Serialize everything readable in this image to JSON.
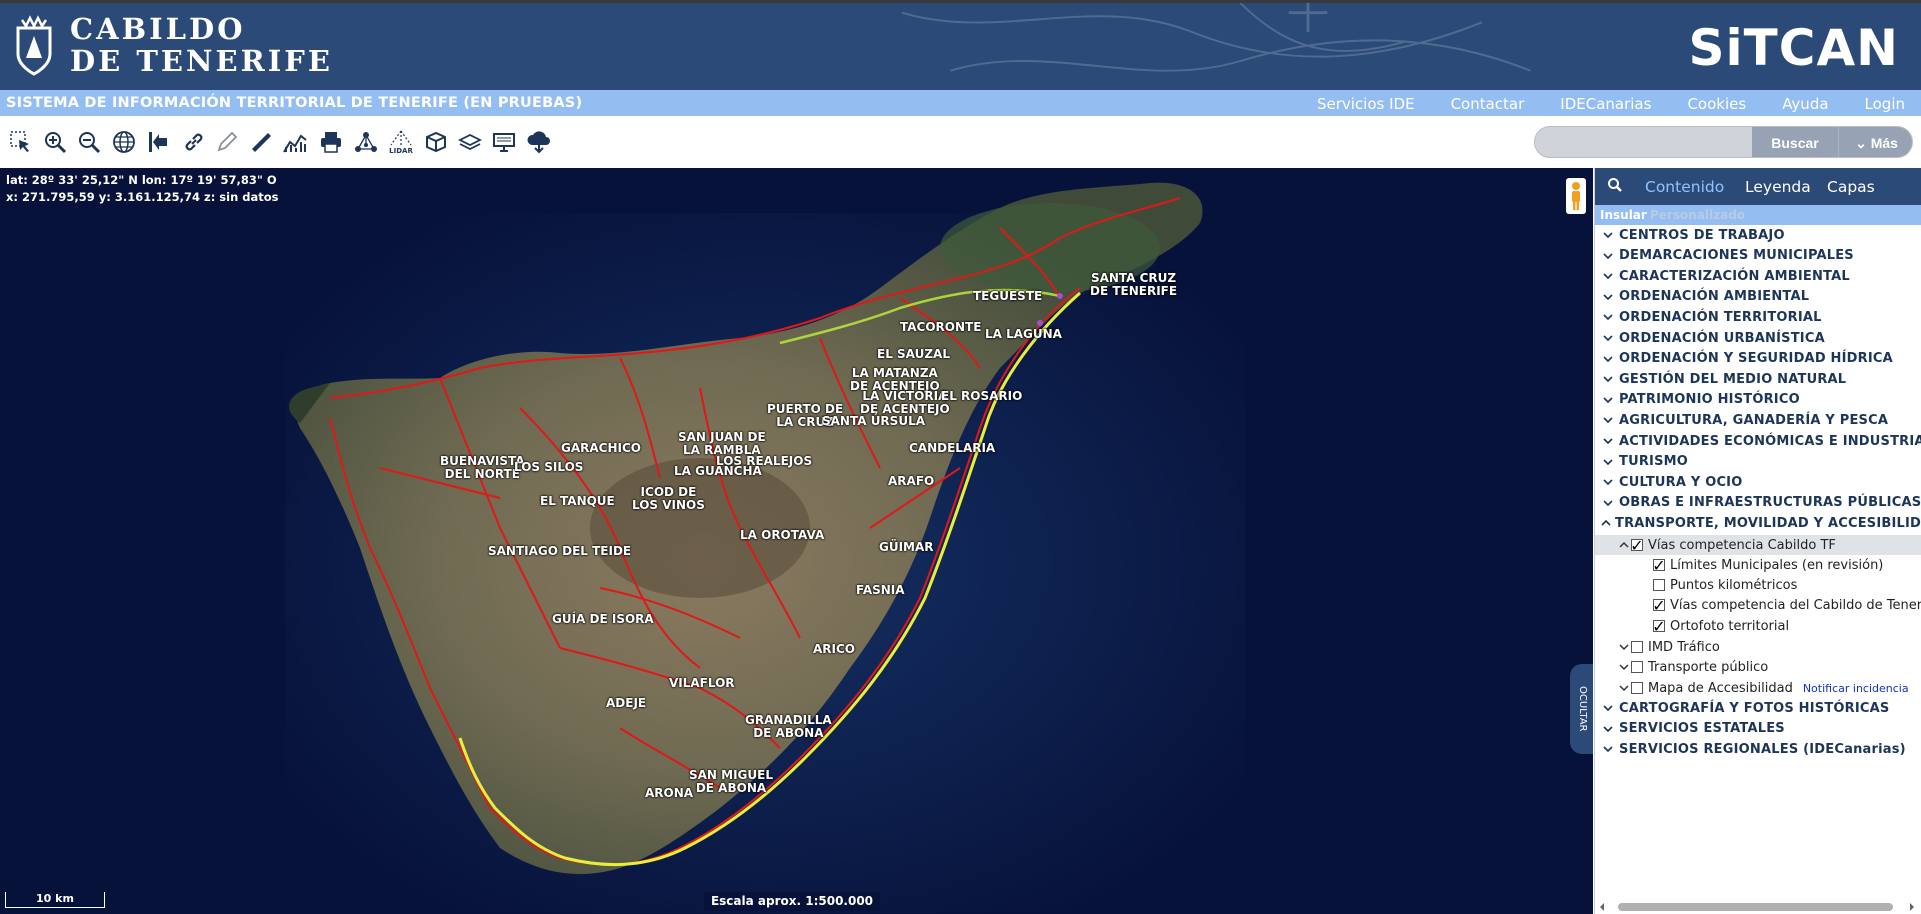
{
  "header": {
    "logo_line1": "CABILDO",
    "logo_line2": "DE TENERIFE",
    "brand": "SiTCAN",
    "brand_color": "#2b4a78"
  },
  "menubar": {
    "title": "SISTEMA DE INFORMACIÓN TERRITORIAL DE TENERIFE (EN PRUEBAS)",
    "links": [
      "Servicios IDE",
      "Contactar",
      "IDECanarias",
      "Cookies",
      "Ayuda",
      "Login"
    ],
    "color": "#94bdf2"
  },
  "toolbar": {
    "tools": [
      "select-icon",
      "zoom-in-icon",
      "zoom-out-icon",
      "globe-icon",
      "exit-icon",
      "link-icon",
      "pencil-icon",
      "measure-icon",
      "profile-chart-icon",
      "print-icon",
      "network-icon",
      "lidar-icon",
      "3d-box-icon",
      "layers-icon",
      "screen-icon",
      "cloud-download-icon"
    ],
    "lidar_label": "LIDAR",
    "search_placeholder": "",
    "search_label": "Buscar",
    "more_label": "Más"
  },
  "map": {
    "coords_line1": "lat: 28º 33' 25,12\" N  lon: 17º 19' 57,83\" O",
    "coords_line2": "x: 271.795,59  y: 3.161.125,74  z: sin datos",
    "scalebar_label": "10 km",
    "scale_text": "Escala aprox. 1:500.000",
    "hide_label": "OCULTAR",
    "place_labels": [
      "SANTA CRUZ\nDE TENERIFE",
      "TEGUESTE",
      "TACORONTE",
      "LA LAGUNA",
      "EL SAUZAL",
      "LA MATANZA\nDE ACENTEJO",
      "LA VICTORIA\nDE ACENTEJO",
      "EL ROSARIO",
      "PUERTO DE\nLA CRUZ",
      "SANTA ÚRSULA",
      "SAN JUAN DE\nLA RAMBLA",
      "LOS REALEJOS",
      "GARACHICO",
      "BUENAVISTA\nDEL NORTE",
      "LOS SILOS",
      "LA GUANCHA",
      "ICOD DE\nLOS VINOS",
      "EL TANQUE",
      "CANDELARIA",
      "ARAFO",
      "LA OROTAVA",
      "GÜIMAR",
      "SANTIAGO DEL TEIDE",
      "FASNIA",
      "GUÍA DE ISORA",
      "ARICO",
      "VILAFLOR",
      "ADEJE",
      "GRANADILLA\nDE ABONA",
      "SAN MIGUEL\nDE ABONA",
      "ARONA"
    ]
  },
  "panel": {
    "tabs": [
      "Contenido",
      "Leyenda",
      "Capas"
    ],
    "subtabs": [
      "Insular",
      "Personalizado"
    ],
    "categories_top": [
      "CENTROS DE TRABAJO",
      "DEMARCACIONES MUNICIPALES",
      "CARACTERIZACIÓN AMBIENTAL",
      "ORDENACIÓN AMBIENTAL",
      "ORDENACIÓN TERRITORIAL",
      "ORDENACIÓN URBANÍSTICA",
      "ORDENACIÓN Y SEGURIDAD HÍDRICA",
      "GESTIÓN DEL MEDIO NATURAL",
      "PATRIMONIO HISTÓRICO",
      "AGRICULTURA, GANADERÍA Y PESCA",
      "ACTIVIDADES ECONÓMICAS E INDUSTRIA",
      "TURISMO",
      "CULTURA Y OCIO",
      "OBRAS E INFRAESTRUCTURAS PÚBLICAS",
      "TRANSPORTE, MOVILIDAD Y ACCESIBILIDAD"
    ],
    "transport_group": {
      "label": "Vías competencia Cabildo TF",
      "checked": true,
      "children": [
        {
          "label": "Límites Municipales (en revisión)",
          "checked": true
        },
        {
          "label": "Puntos kilométricos",
          "checked": false
        },
        {
          "label": "Vías competencia del Cabildo de Tenerife",
          "checked": true
        },
        {
          "label": "Ortofoto territorial",
          "checked": true
        }
      ]
    },
    "sibling_groups": [
      {
        "label": "IMD Tráfico",
        "checked": false
      },
      {
        "label": "Transporte público",
        "checked": false
      },
      {
        "label": "Mapa de Accesibilidad",
        "checked": false
      }
    ],
    "notify_label": "Notificar incidencia",
    "categories_bottom": [
      "CARTOGRAFÍA Y FOTOS HISTÓRICAS",
      "SERVICIOS ESTATALES",
      "SERVICIOS REGIONALES (IDECanarias)"
    ]
  }
}
